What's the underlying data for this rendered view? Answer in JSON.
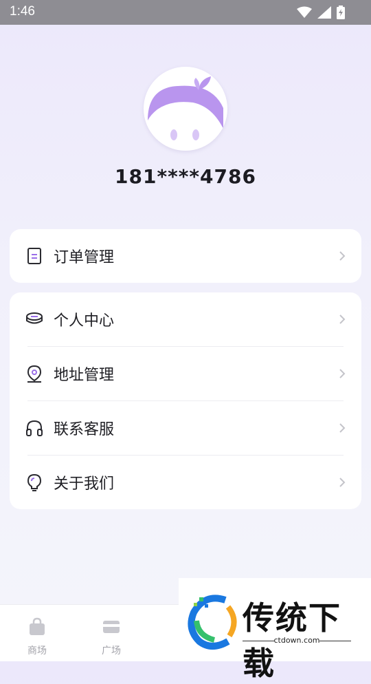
{
  "status_bar": {
    "time": "1:46",
    "icons": [
      "wifi-icon",
      "signal-icon",
      "battery-icon"
    ]
  },
  "profile": {
    "phone": "181****4786",
    "avatar": "avatar-illustration"
  },
  "menu_card_1": {
    "items": [
      {
        "label": "订单管理",
        "icon": "order-document-icon"
      }
    ]
  },
  "menu_card_2": {
    "items": [
      {
        "label": "个人中心",
        "icon": "coin-stack-icon"
      },
      {
        "label": "地址管理",
        "icon": "location-pin-icon"
      },
      {
        "label": "联系客服",
        "icon": "headset-icon"
      },
      {
        "label": "关于我们",
        "icon": "lightbulb-icon"
      }
    ]
  },
  "tab_bar": {
    "tabs": [
      {
        "label": "商场",
        "icon": "shopping-bag-icon"
      },
      {
        "label": "广场",
        "icon": "card-icon"
      }
    ]
  },
  "watermark": {
    "title": "传统下载",
    "url": "ctdown.com"
  },
  "colors": {
    "accent": "#b79af0",
    "text": "#1f1f24",
    "muted": "#a3a3aa"
  }
}
